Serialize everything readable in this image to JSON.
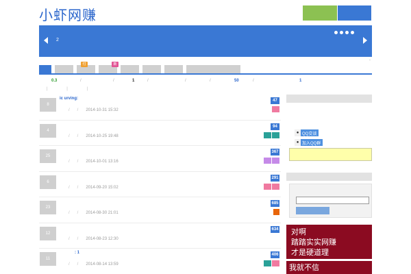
{
  "header": {
    "logo_text": "小虾网赚"
  },
  "banner": {
    "slide_number": "2"
  },
  "misc": {
    "tiny_mark": "-"
  },
  "tabs": {
    "badges": [
      {
        "text": "付",
        "color": "#f0a030"
      },
      {
        "text": "新",
        "color": "#e25595"
      }
    ]
  },
  "stats": {
    "value_1": "0.3",
    "value_2": "1",
    "value_3": "50",
    "value_4": "1",
    "separator": "/"
  },
  "posts": [
    {
      "thumb": "8",
      "title": "ic urving:",
      "date": "2014-10-31 15:32",
      "count": "47",
      "tags": [
        "#f07aa0"
      ]
    },
    {
      "thumb": "4",
      "title": "",
      "date": "2014-10-25 19:48",
      "count": "94",
      "tags": [
        "#2aa198",
        "#2aa198"
      ]
    },
    {
      "thumb": "25",
      "title": "",
      "date": "2014-10-01 13:16",
      "count": "367",
      "tags": [
        "#c58ae8",
        "#c58ae8"
      ]
    },
    {
      "thumb": "6",
      "title": "",
      "date": "2014-09-20 15:02",
      "count": "291",
      "tags": [
        "#f07aa0",
        "#f07aa0"
      ]
    },
    {
      "thumb": "23",
      "title": "",
      "date": "2014-08-30 21:01",
      "count": "685",
      "tags": [
        "#e8650a"
      ]
    },
    {
      "thumb": "12",
      "title": "",
      "date": "2014-08-23 12:30",
      "count": "634",
      "tags": []
    },
    {
      "thumb": "11",
      "title": ":     1",
      "date": "2014-08-14 13:59",
      "count": "406",
      "tags": [
        "#2aa198",
        "#f07aa0"
      ]
    }
  ],
  "sidebar": {
    "qq_chat_label": "QQ交谈",
    "qq_group_label": "加入QQ群",
    "ad_lines": [
      "对啊",
      "踏踏实实网赚",
      "才是硬道理"
    ],
    "ad2_text": "我就不信"
  },
  "colors": {
    "brand_blue": "#3a78d4",
    "green": "#8cc152",
    "ad_red": "#8b0b21"
  }
}
